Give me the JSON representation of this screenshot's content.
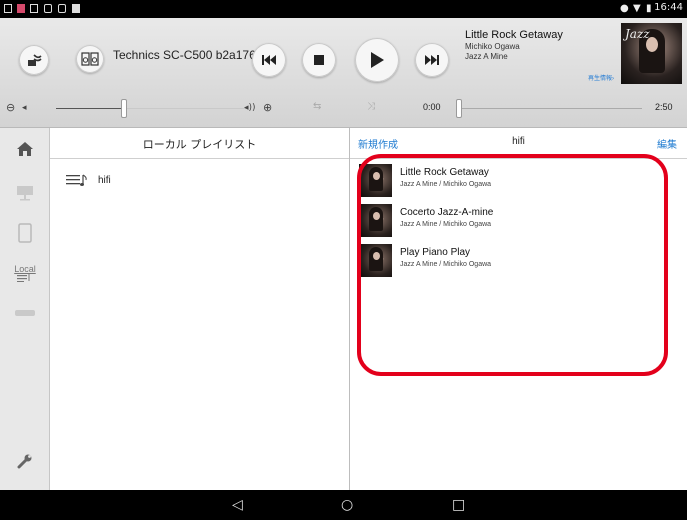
{
  "status_bar": {
    "time": "16:44",
    "icons": [
      "notification-icon",
      "app-icon",
      "screen-icon",
      "download-icon",
      "download-icon",
      "download-icon"
    ]
  },
  "header": {
    "device_name": "Technics SC-C500 b2a176",
    "now_playing": {
      "title": "Little Rock Getaway",
      "artist": "Michiko Ogawa",
      "album": "Jazz A Mine",
      "info_link": "再生情報›",
      "album_art_text": "Jazz"
    },
    "elapsed": "0:00",
    "duration": "2:50",
    "volume_level": 0.3,
    "seek_level": 0.0
  },
  "sidebar": {
    "items": [
      {
        "name": "home-icon"
      },
      {
        "name": "network-icon"
      },
      {
        "name": "tablet-icon"
      },
      {
        "name": "local-playlist-icon",
        "label": "Local"
      },
      {
        "name": "speaker-icon"
      },
      {
        "name": "settings-wrench-icon"
      }
    ]
  },
  "left_panel": {
    "title": "ローカル プレイリスト",
    "playlists": [
      {
        "label": "hifi"
      }
    ]
  },
  "right_panel": {
    "new_label": "新規作成",
    "title": "hifi",
    "edit_label": "編集",
    "tracks": [
      {
        "title": "Little Rock Getaway",
        "subtitle": "Jazz A Mine / Michiko Ogawa"
      },
      {
        "title": "Cocerto Jazz-A-mine",
        "subtitle": "Jazz A Mine / Michiko Ogawa"
      },
      {
        "title": "Play Piano Play",
        "subtitle": "Jazz A Mine / Michiko Ogawa"
      }
    ]
  },
  "colors": {
    "accent_link": "#1d7ad0",
    "highlight": "#e3001b"
  }
}
